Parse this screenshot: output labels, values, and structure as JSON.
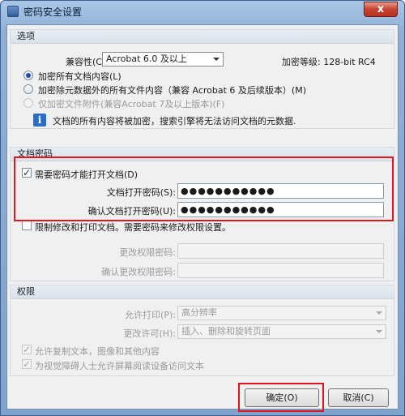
{
  "window": {
    "title": "密码安全设置",
    "close_glyph": "x"
  },
  "options": {
    "header": "选项",
    "compat_label": "兼容性(C):",
    "compat_value": "Acrobat 6.0 及以上",
    "encryption_level": "加密等级: 128-bit RC4",
    "radio_all": "加密所有文档内容(L)",
    "radio_except_meta": "加密除元数据外的所有文件内容（兼容 Acrobat 6 及后续版本）(M)",
    "radio_attachments": "仅加密文件附件(兼容Acrobat 7及以上版本)(F)",
    "info_glyph": "i",
    "info_text": "文档的所有内容将被加密，搜索引擎将无法访问文档的元数据."
  },
  "doc_password": {
    "header": "文档密码",
    "require_label": "需要密码才能打开文档(D)",
    "check_glyph": "✓",
    "open_label": "文档打开密码(S):",
    "open_value": "●●●●●●●●●●●",
    "confirm_label": "确认文档打开密码(U):",
    "confirm_value": "●●●●●●●●●●●"
  },
  "restrict": {
    "label": "限制修改和打印文档。需要密码来修改权限设置。",
    "change_label": "更改权限密码:",
    "confirm_change_label": "确认更改权限密码:"
  },
  "permissions": {
    "header": "权限",
    "print_label": "允许打印(P):",
    "print_value": "高分辨率",
    "change_label": "更改许可(H):",
    "change_value": "插入、删除和旋转页面",
    "copy_label": "允许复制文本，图像和其他内容",
    "screen_reader_label": "为视觉障碍人士允许屏幕阅读设备访问文本"
  },
  "buttons": {
    "ok": "确定(O)",
    "cancel": "取消(C)"
  },
  "colors": {
    "highlight": "#e0141e",
    "accent": "#1d4fa8"
  }
}
